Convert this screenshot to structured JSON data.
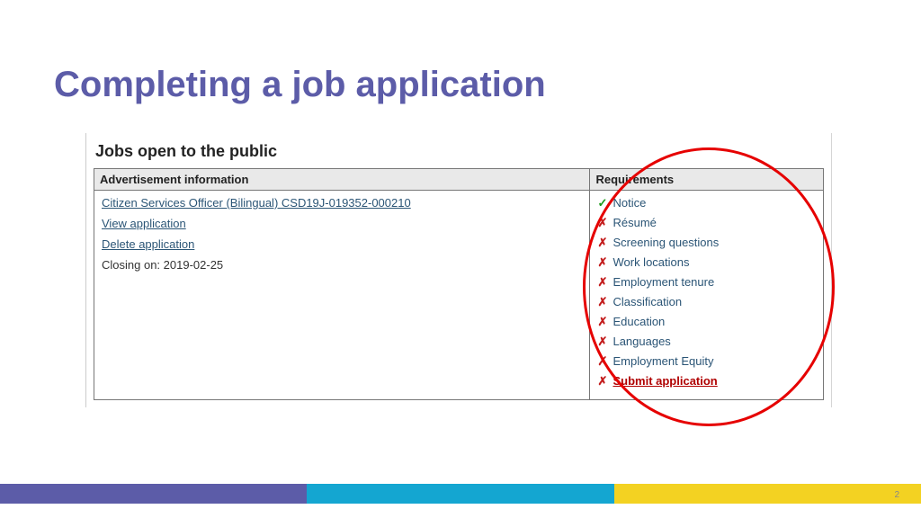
{
  "title": "Completing a job application",
  "panel_header": "Jobs open to the public",
  "table": {
    "col_ad": "Advertisement information",
    "col_req": "Requirements"
  },
  "ad": {
    "job_link": "Citizen Services Officer (Bilingual) CSD19J-019352-000210",
    "view_link": "View application",
    "delete_link": "Delete application",
    "closing": "Closing on: 2019-02-25"
  },
  "requirements": [
    {
      "status": "check",
      "label": "Notice"
    },
    {
      "status": "x",
      "label": "Résumé"
    },
    {
      "status": "x",
      "label": "Screening questions"
    },
    {
      "status": "x",
      "label": "Work locations"
    },
    {
      "status": "x",
      "label": "Employment tenure"
    },
    {
      "status": "x",
      "label": "Classification"
    },
    {
      "status": "x",
      "label": "Education"
    },
    {
      "status": "x",
      "label": "Languages"
    },
    {
      "status": "x",
      "label": "Employment Equity"
    }
  ],
  "submit_label": "Submit application",
  "page_number": "2"
}
